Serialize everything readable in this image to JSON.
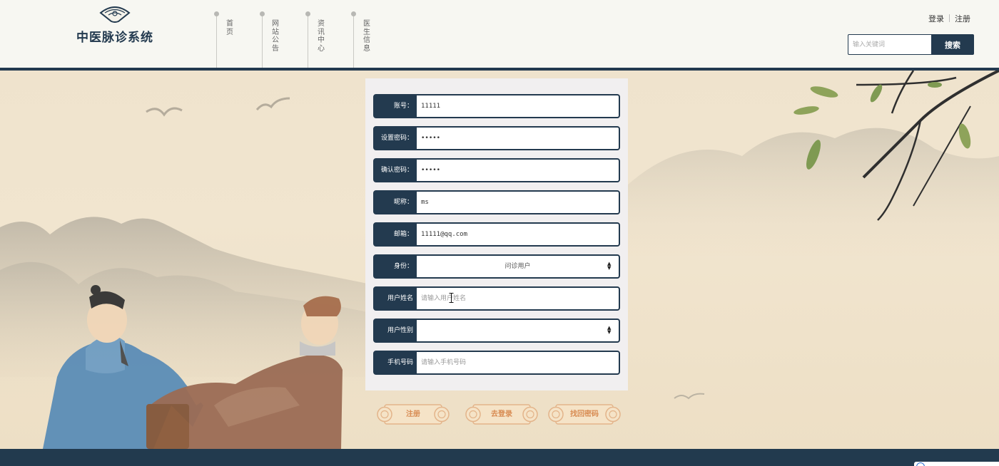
{
  "app": {
    "title": "中医脉诊系统"
  },
  "header": {
    "nav": [
      {
        "label": "首页"
      },
      {
        "label": "网站公告"
      },
      {
        "label": "资讯中心"
      },
      {
        "label": "医生信息"
      }
    ],
    "login_label": "登录",
    "register_label": "注册",
    "search": {
      "placeholder": "输入关键词",
      "button_label": "搜索"
    }
  },
  "form": {
    "fields": [
      {
        "label": "账号：",
        "value": "11111"
      },
      {
        "label": "设置密码：",
        "value": "•••••"
      },
      {
        "label": "确认密码：",
        "value": "•••••"
      },
      {
        "label": "昵称：",
        "value": "ms"
      },
      {
        "label": "邮箱：",
        "value": "11111@qq.com"
      },
      {
        "label": "身份：",
        "value": "问诊用户"
      },
      {
        "label": "用户姓名",
        "placeholder": "请输入用户姓名"
      },
      {
        "label": "用户性别",
        "value": ""
      },
      {
        "label": "手机号码",
        "placeholder": "请输入手机号码"
      }
    ],
    "buttons": {
      "register": "注册",
      "go_login": "去登录",
      "recover": "找回密码"
    }
  },
  "colors": {
    "primary": "#233a4f",
    "button_text": "#d88b52",
    "panel": "#f1eff0"
  },
  "icons": {
    "logo": "fan-logo-icon",
    "select_caret": "updown-caret-icon",
    "text_cursor": "ibeam-cursor-icon"
  }
}
